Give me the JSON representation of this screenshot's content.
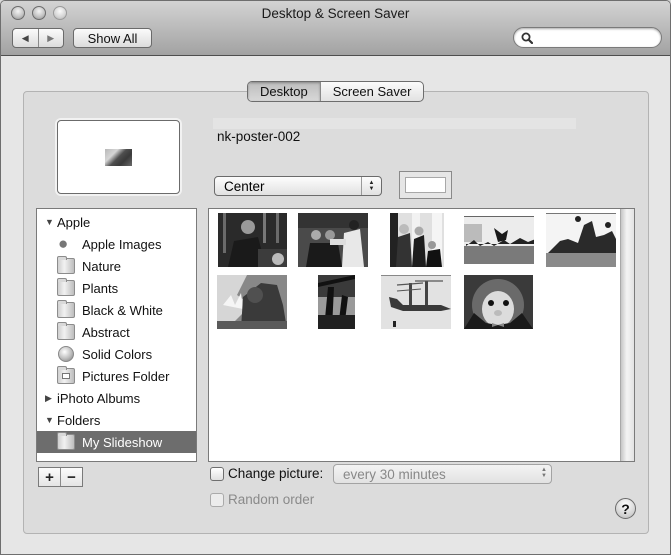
{
  "window": {
    "title": "Desktop & Screen Saver",
    "toolbar": {
      "back_icon": "◀",
      "forward_icon": "▶",
      "show_all_label": "Show All",
      "search_placeholder": "",
      "search_value": ""
    }
  },
  "tabs": [
    {
      "label": "Desktop",
      "active": true
    },
    {
      "label": "Screen Saver",
      "active": false
    }
  ],
  "current_image": {
    "name": "nk-poster-002"
  },
  "placement": {
    "selected": "Center",
    "arrows": "▲▼"
  },
  "background_color": "#ffffff",
  "source_list": {
    "groups": [
      {
        "label": "Apple",
        "expanded": true,
        "items": [
          {
            "label": "Apple Images",
            "icon": "apple-icon"
          },
          {
            "label": "Nature",
            "icon": "folder-icon"
          },
          {
            "label": "Plants",
            "icon": "folder-icon"
          },
          {
            "label": "Black & White",
            "icon": "folder-icon"
          },
          {
            "label": "Abstract",
            "icon": "folder-icon"
          },
          {
            "label": "Solid Colors",
            "icon": "globe-icon"
          },
          {
            "label": "Pictures Folder",
            "icon": "pictures-folder-icon"
          }
        ]
      },
      {
        "label": "iPhoto Albums",
        "expanded": false,
        "items": []
      },
      {
        "label": "Folders",
        "expanded": true,
        "items": [
          {
            "label": "My Slideshow",
            "icon": "folder-icon",
            "selected": true
          }
        ]
      }
    ],
    "tri_expanded": "▼",
    "tri_collapsed": "▶"
  },
  "list_buttons": {
    "add": "+",
    "remove": "−"
  },
  "thumbnails": [
    {
      "subject": "president at podium"
    },
    {
      "subject": "people seated reading"
    },
    {
      "subject": "men standing by columns"
    },
    {
      "subject": "soldiers jumping on field"
    },
    {
      "subject": "soldiers jumping in formation"
    },
    {
      "subject": "propaganda poster soldier"
    },
    {
      "subject": "silhouette tree"
    },
    {
      "subject": "tiltrotor aircraft"
    },
    {
      "subject": "penguin plush toy"
    }
  ],
  "change_picture": {
    "label": "Change picture:",
    "checked": false,
    "interval": "every 30 minutes"
  },
  "random_order": {
    "label": "Random order",
    "checked": false,
    "enabled": false
  },
  "help": {
    "label": "?"
  }
}
